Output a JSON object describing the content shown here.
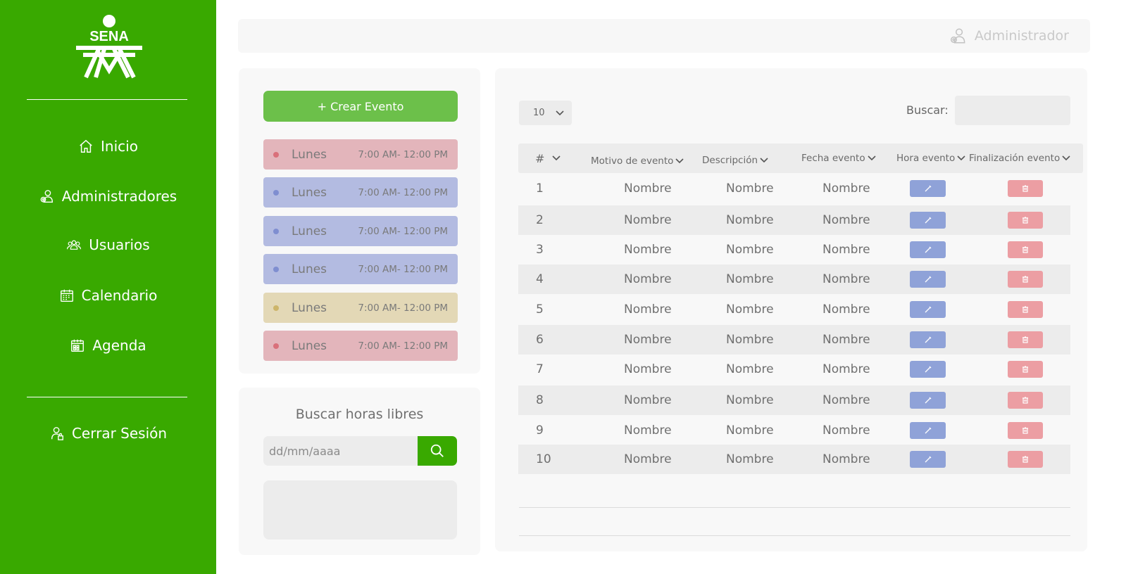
{
  "brand": {
    "logo_text": "SENA"
  },
  "sidebar": {
    "items": [
      {
        "label": "Inicio",
        "icon": "home-icon"
      },
      {
        "label": "Administradores",
        "icon": "admin-user-icon"
      },
      {
        "label": "Usuarios",
        "icon": "users-icon"
      },
      {
        "label": "Calendario",
        "icon": "calendar-icon"
      },
      {
        "label": "Agenda",
        "icon": "agenda-icon"
      }
    ],
    "logout_label": "Cerrar Sesión"
  },
  "header": {
    "user_label": "Administrador"
  },
  "events": {
    "create_label": "+ Crear Evento",
    "cards": [
      {
        "day": "Lunes",
        "time": "7:00 AM- 12:00 PM",
        "bg": "#e3b5bb",
        "dot": "#d9707a"
      },
      {
        "day": "Lunes",
        "time": "7:00 AM- 12:00 PM",
        "bg": "#b3bbe1",
        "dot": "#7f8ed0"
      },
      {
        "day": "Lunes",
        "time": "7:00 AM- 12:00 PM",
        "bg": "#b3bbe1",
        "dot": "#7f8ed0"
      },
      {
        "day": "Lunes",
        "time": "7:00 AM- 12:00 PM",
        "bg": "#b3bbe1",
        "dot": "#7f8ed0"
      },
      {
        "day": "Lunes",
        "time": "7:00 AM- 12:00 PM",
        "bg": "#e3d8b6",
        "dot": "#cdb56a"
      },
      {
        "day": "Lunes",
        "time": "7:00 AM- 12:00 PM",
        "bg": "#e3b5bb",
        "dot": "#d9707a"
      }
    ]
  },
  "free_hours": {
    "title": "Buscar horas libres",
    "date_placeholder": "dd/mm/aaaa"
  },
  "table": {
    "page_size": "10",
    "search_label": "Buscar:",
    "columns": [
      "#",
      "Motivo de evento",
      "Descripción",
      "Fecha evento",
      "Hora evento",
      "Finalización evento"
    ],
    "rows": [
      {
        "num": "1",
        "motivo": "Nombre",
        "descripcion": "Nombre",
        "fecha": "Nombre"
      },
      {
        "num": "2",
        "motivo": "Nombre",
        "descripcion": "Nombre",
        "fecha": "Nombre"
      },
      {
        "num": "3",
        "motivo": "Nombre",
        "descripcion": "Nombre",
        "fecha": "Nombre"
      },
      {
        "num": "4",
        "motivo": "Nombre",
        "descripcion": "Nombre",
        "fecha": "Nombre"
      },
      {
        "num": "5",
        "motivo": "Nombre",
        "descripcion": "Nombre",
        "fecha": "Nombre"
      },
      {
        "num": "6",
        "motivo": "Nombre",
        "descripcion": "Nombre",
        "fecha": "Nombre"
      },
      {
        "num": "7",
        "motivo": "Nombre",
        "descripcion": "Nombre",
        "fecha": "Nombre"
      },
      {
        "num": "8",
        "motivo": "Nombre",
        "descripcion": "Nombre",
        "fecha": "Nombre"
      },
      {
        "num": "9",
        "motivo": "Nombre",
        "descripcion": "Nombre",
        "fecha": "Nombre"
      },
      {
        "num": "10",
        "motivo": "Nombre",
        "descripcion": "Nombre",
        "fecha": "Nombre"
      }
    ]
  },
  "colors": {
    "sidebar": "#39a900",
    "create_button": "#6cc04a",
    "edit_button": "#8fa2d8",
    "delete_button": "#ec9ea3"
  }
}
